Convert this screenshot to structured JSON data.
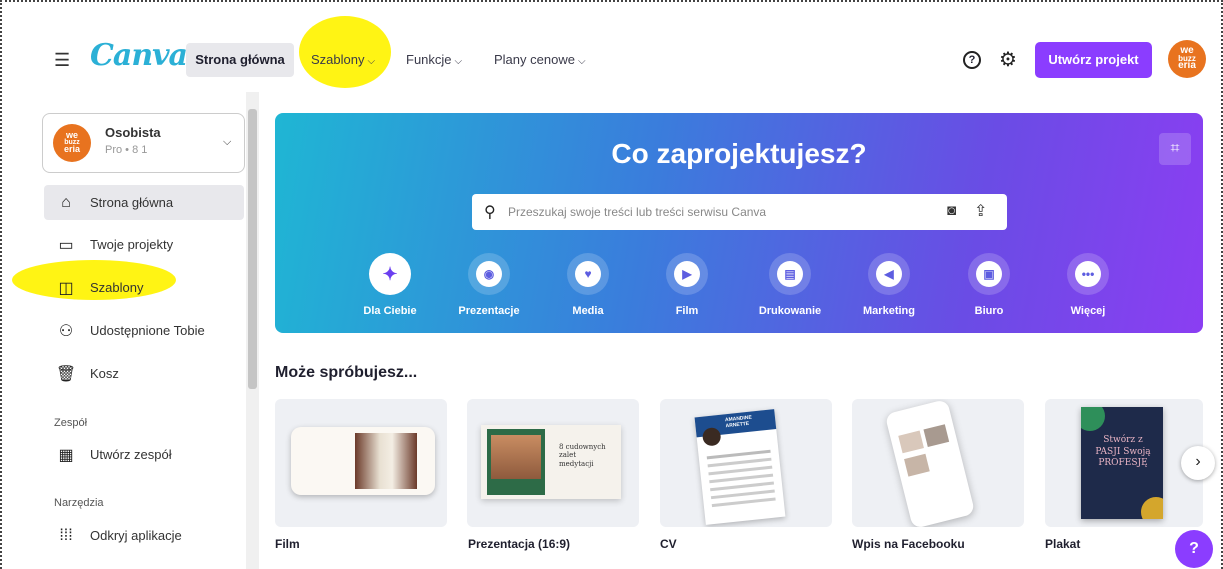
{
  "header": {
    "logo": "Canva",
    "nav": {
      "home": "Strona główna",
      "templates": "Szablony",
      "features": "Funkcje",
      "pricing": "Plany cenowe"
    },
    "create_button": "Utwórz projekt",
    "avatar_text": [
      "we",
      "buzz",
      "eria"
    ]
  },
  "sidebar": {
    "account": {
      "name": "Osobista",
      "plan": "Pro • 8 1"
    },
    "items": [
      {
        "label": "Strona główna",
        "icon": "home-icon"
      },
      {
        "label": "Twoje projekty",
        "icon": "folder-icon"
      },
      {
        "label": "Szablony",
        "icon": "templates-icon"
      },
      {
        "label": "Udostępnione Tobie",
        "icon": "shared-icon"
      },
      {
        "label": "Kosz",
        "icon": "trash-icon"
      }
    ],
    "team_section": "Zespół",
    "create_team": "Utwórz zespół",
    "tools_section": "Narzędzia",
    "apps": "Odkryj aplikacje"
  },
  "banner": {
    "title": "Co zaprojektujesz?",
    "search_placeholder": "Przeszukaj swoje treści lub treści serwisu Canva",
    "categories": [
      {
        "label": "Dla Ciebie",
        "icon": "sparkle-icon"
      },
      {
        "label": "Prezentacje",
        "icon": "presentation-icon"
      },
      {
        "label": "Media",
        "icon": "heart-icon"
      },
      {
        "label": "Film",
        "icon": "video-icon"
      },
      {
        "label": "Drukowanie",
        "icon": "print-icon"
      },
      {
        "label": "Marketing",
        "icon": "megaphone-icon"
      },
      {
        "label": "Biuro",
        "icon": "briefcase-icon"
      },
      {
        "label": "Więcej",
        "icon": "more-icon"
      }
    ]
  },
  "suggestions": {
    "title": "Może spróbujesz...",
    "items": [
      {
        "label": "Film"
      },
      {
        "label": "Prezentacja (16:9)",
        "thumb_text": "8 cudownych zalet medytacji"
      },
      {
        "label": "CV",
        "thumb_text": "AMANDINE ARNETTE"
      },
      {
        "label": "Wpis na Facebooku"
      },
      {
        "label": "Plakat",
        "thumb_text": "Stwórz z PASJI Swoją PROFESJĘ"
      }
    ]
  },
  "colors": {
    "accent": "#8b3dff",
    "highlight": "#fff300",
    "brand_logo": "#2bb0d6",
    "avatar": "#e8731f"
  }
}
